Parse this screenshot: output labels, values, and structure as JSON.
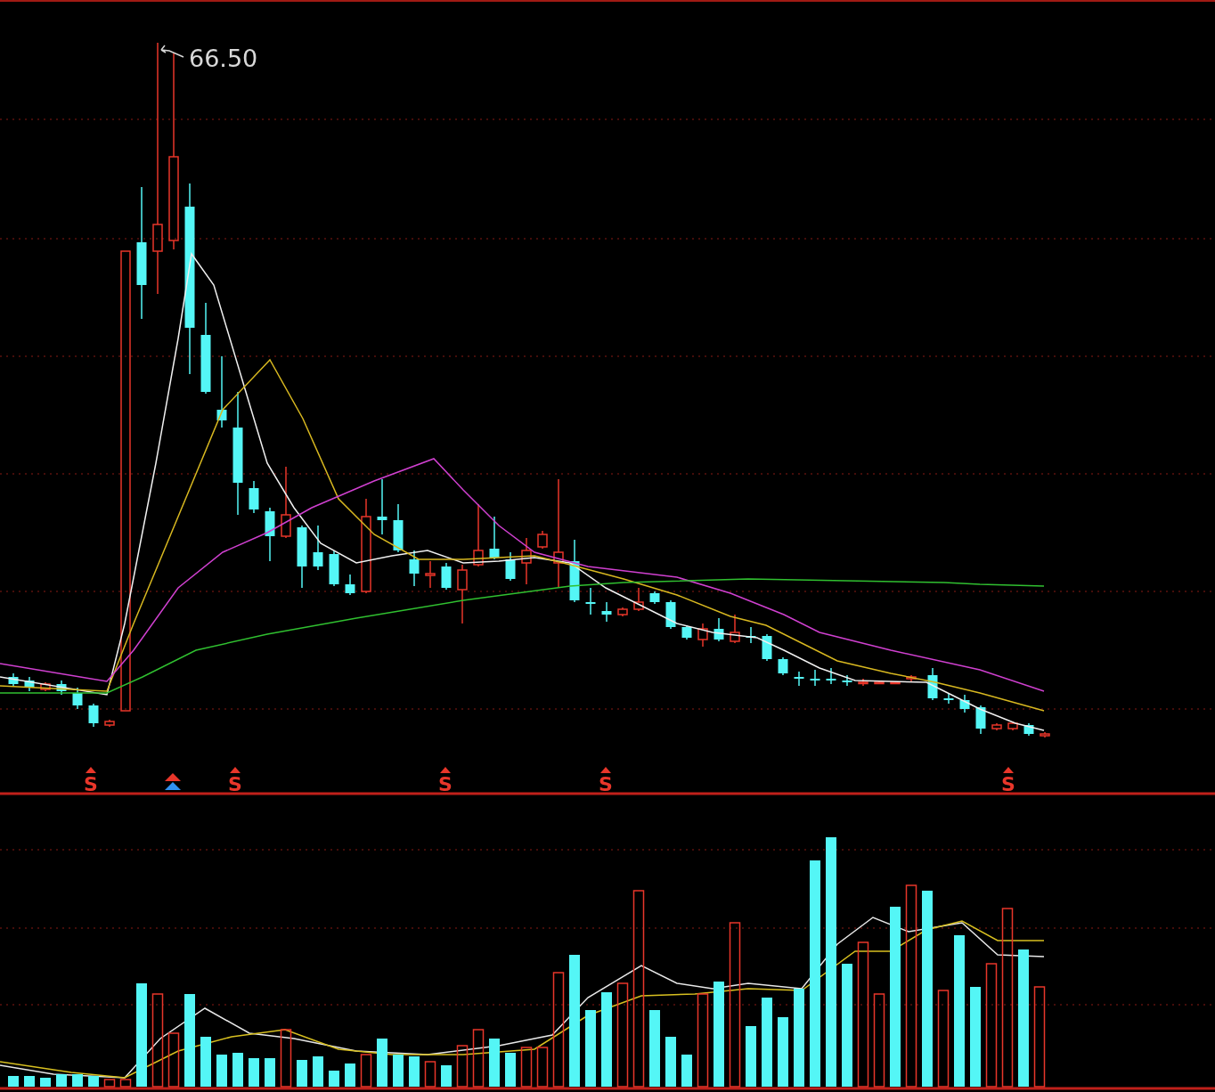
{
  "price_chart": {
    "peak_label": "66.50",
    "signals": [
      {
        "kind": "letter",
        "text": "S"
      },
      {
        "kind": "arrows"
      },
      {
        "kind": "letter",
        "text": "S"
      },
      {
        "kind": "letter",
        "text": "S"
      },
      {
        "kind": "letter",
        "text": "S"
      },
      {
        "kind": "letter",
        "text": "S"
      }
    ]
  }
}
